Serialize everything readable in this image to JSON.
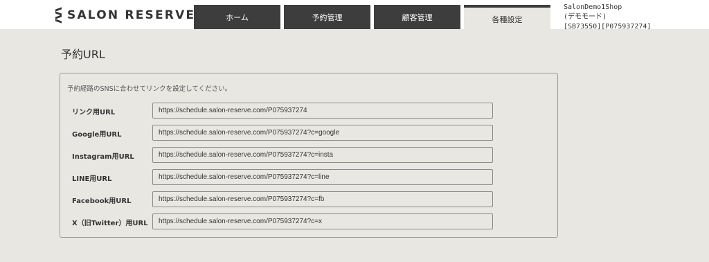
{
  "header": {
    "logo_text": "SALON RESERVE",
    "tabs": [
      {
        "label": "ホーム",
        "active": false
      },
      {
        "label": "予約管理",
        "active": false
      },
      {
        "label": "顧客管理",
        "active": false
      },
      {
        "label": "各種設定",
        "active": true
      }
    ],
    "account": {
      "line1": "SalonDemo1Shop",
      "line2": "(デモモード)",
      "line3": "[SB73550][P075937274]"
    }
  },
  "main": {
    "title": "予約URL",
    "description": "予約経路のSNSに合わせてリンクを設定してください。",
    "rows": [
      {
        "label": "リンク用URL",
        "value": "https://schedule.salon-reserve.com/P075937274"
      },
      {
        "label": "Google用URL",
        "value": "https://schedule.salon-reserve.com/P075937274?c=google"
      },
      {
        "label": "Instagram用URL",
        "value": "https://schedule.salon-reserve.com/P075937274?c=insta"
      },
      {
        "label": "LINE用URL",
        "value": "https://schedule.salon-reserve.com/P075937274?c=line"
      },
      {
        "label": "Facebook用URL",
        "value": "https://schedule.salon-reserve.com/P075937274?c=fb"
      },
      {
        "label": "X（旧Twitter）用URL",
        "value": "https://schedule.salon-reserve.com/P075937274?c=x"
      }
    ]
  },
  "colors": {
    "background": "#e8e7e2",
    "tab_dark": "#3d3d3d",
    "header_bg": "#ffffff"
  }
}
